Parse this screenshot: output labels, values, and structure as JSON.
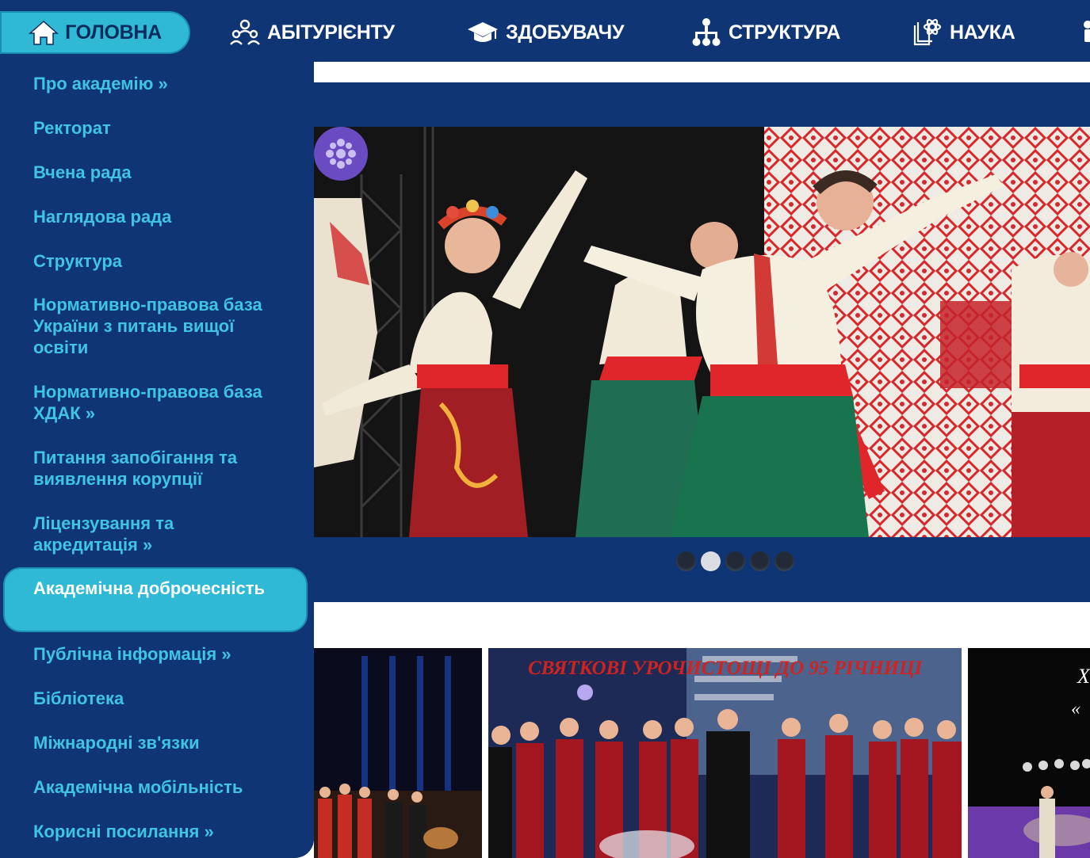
{
  "nav": {
    "items": [
      {
        "label": "ГОЛОВНА",
        "icon": "home-icon"
      },
      {
        "label": "АБІТУРІЄНТУ",
        "icon": "users-icon"
      },
      {
        "label": "ЗДОБУВАЧУ",
        "icon": "graduation-cap-icon"
      },
      {
        "label": "СТРУКТУРА",
        "icon": "sitemap-icon"
      },
      {
        "label": "НАУКА",
        "icon": "book-atom-icon"
      }
    ]
  },
  "sidebar": {
    "items": [
      {
        "label": "Про академію »"
      },
      {
        "label": "Ректорат"
      },
      {
        "label": "Вчена рада"
      },
      {
        "label": "Наглядова рада"
      },
      {
        "label": "Структура"
      },
      {
        "label": "Нормативно-правова база України з питань вищої освіти"
      },
      {
        "label": "Нормативно-правова база ХДАК »"
      },
      {
        "label": "Питання запобігання та виявлення корупції"
      },
      {
        "label": "Ліцензування та акредитація »"
      },
      {
        "label": "Академічна доброчесність",
        "active": true
      },
      {
        "label": "Публічна інформація »"
      },
      {
        "label": "Бібліотека"
      },
      {
        "label": "Міжнародні зв'язки"
      },
      {
        "label": "Академічна мобільність"
      },
      {
        "label": "Корисні посилання »"
      }
    ]
  },
  "slider": {
    "dot_count": 5,
    "active_dot": 2
  },
  "news": {
    "thumb2_caption": "СВЯТКОВІ УРОЧИСТОЩІ ДО 95 РІЧНИЦІ"
  },
  "colors": {
    "navy": "#0f3575",
    "accent": "#2fb9d4",
    "link": "#3fc3e6"
  }
}
